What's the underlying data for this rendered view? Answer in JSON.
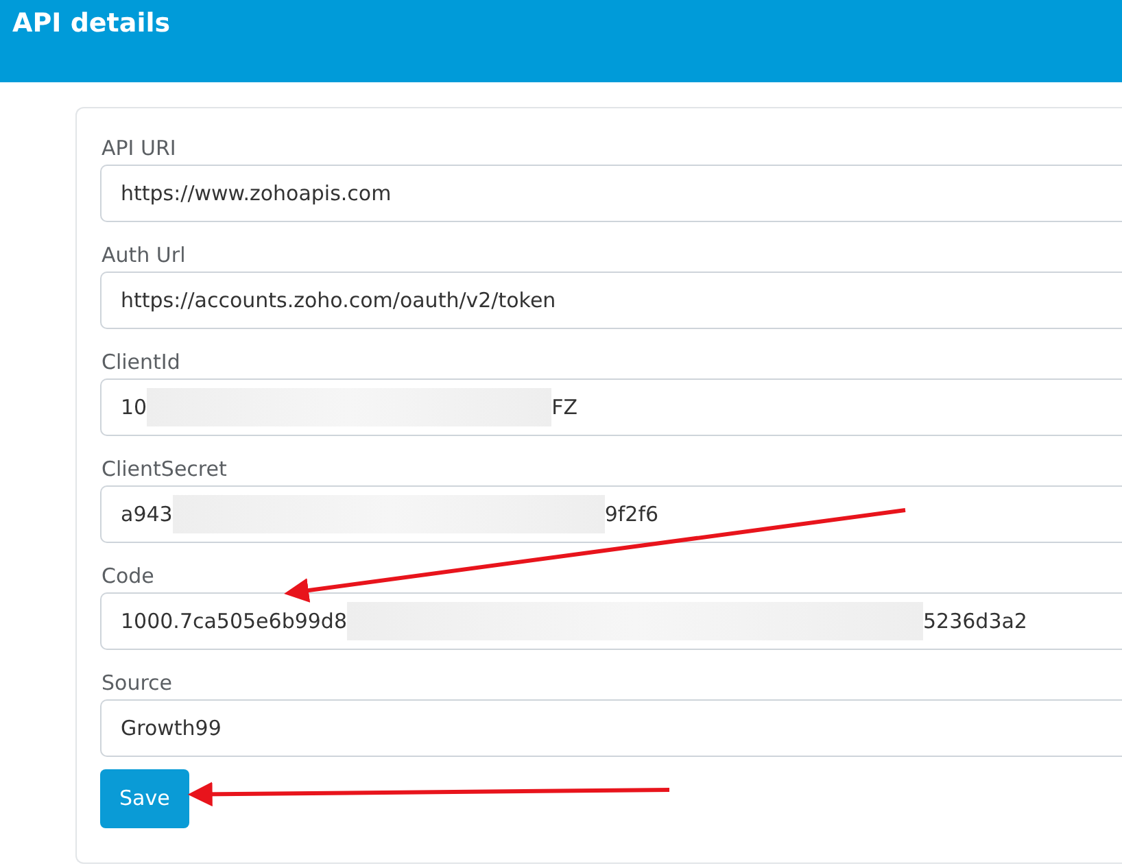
{
  "header": {
    "title": "API details"
  },
  "fields": [
    {
      "label": "API URI",
      "value": "https://www.zohoapis.com",
      "redacted": false,
      "arrow_marked": false
    },
    {
      "label": "Auth Url",
      "value": "https://accounts.zoho.com/oauth/v2/token",
      "redacted": false,
      "arrow_marked": false
    },
    {
      "label": "ClientId",
      "value": "10",
      "value_end": "FZ",
      "redacted": true,
      "arrow_marked": false
    },
    {
      "label": "ClientSecret",
      "value": "a943",
      "value_end": "9f2f6",
      "redacted": true,
      "arrow_marked": false
    },
    {
      "label": "Code",
      "value": "1000.7ca505e6b99d8",
      "value_end": "5236d3a2",
      "redacted": true,
      "arrow_marked": true
    },
    {
      "label": "Source",
      "value": "Growth99",
      "redacted": false,
      "arrow_marked": false
    }
  ],
  "save_button": {
    "label": "Save",
    "arrow_marked": true
  }
}
